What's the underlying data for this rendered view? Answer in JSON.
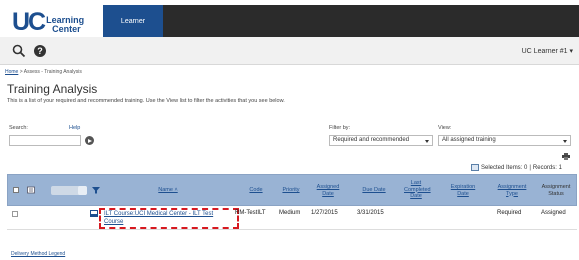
{
  "app": {
    "logo_main": "UC",
    "logo_sub_1": "Learning",
    "logo_sub_2": "Center",
    "active_tab": "Learner",
    "user_menu": "UC Learner #1 ▾"
  },
  "icons": {
    "search": "search-icon",
    "help": "help-icon",
    "print": "print-icon",
    "selected": "selected-items-icon"
  },
  "breadcrumb": {
    "home": "Home",
    "rest": " > Assess - Training Analysis"
  },
  "page": {
    "title": "Training Analysis",
    "description": "This is a list of your required and recommended training. Use the View list to filter the activities that you see below."
  },
  "filters": {
    "search_label": "Search:",
    "help_link": "Help",
    "search_value": "",
    "filter_by_label": "Filter by:",
    "filter_by_value": "Required and recommended",
    "view_label": "View:",
    "view_value": "All assigned training"
  },
  "grid_status": {
    "selected_items": "Selected Items: 0",
    "separator": "|",
    "records": "Records: 1"
  },
  "table": {
    "headers": {
      "name": "Name ˄",
      "code": "Code",
      "priority": "Priority",
      "assigned_date": "Assigned Date",
      "due_date": "Due Date",
      "last_completed_date": "Last Completed Date",
      "expiration_date": "Expiration Date",
      "assignment_type": "Assignment Type",
      "assignment_status": "Assignment Status"
    },
    "rows": [
      {
        "name": "ILT Course:UCI Medical Center - ILT Test Course",
        "code": "RM-TestILT",
        "priority": "Medium",
        "assigned_date": "1/27/2015",
        "due_date": "3/31/2015",
        "last_completed_date": "",
        "expiration_date": "",
        "assignment_type": "Required",
        "assignment_status": "Assigned"
      }
    ]
  },
  "footer": {
    "legend_link": "Delivery Method Legend"
  },
  "colors": {
    "brand_blue": "#1d4f8f",
    "header_row": "#99b3d4",
    "highlight": "#d71920"
  }
}
